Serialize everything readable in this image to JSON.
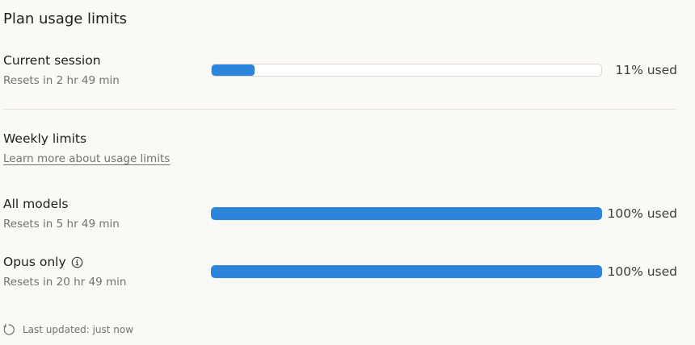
{
  "header": {
    "title": "Plan usage limits"
  },
  "current_session": {
    "label": "Current session",
    "resets": "Resets in 2 hr 49 min",
    "percent_used": 11,
    "percent_text": "11% used"
  },
  "weekly": {
    "heading": "Weekly limits",
    "learn_more": "Learn more about usage limits"
  },
  "all_models": {
    "label": "All models",
    "resets": "Resets in 5 hr 49 min",
    "percent_used": 100,
    "percent_text": "100% used"
  },
  "opus_only": {
    "label": "Opus only",
    "resets": "Resets in 20 hr 49 min",
    "percent_used": 100,
    "percent_text": "100% used",
    "info_icon": "info-icon"
  },
  "footer": {
    "refresh_icon": "refresh-icon",
    "last_updated": "Last updated: just now"
  },
  "colors": {
    "bar_fill": "#2c84db",
    "background": "#faf9f5",
    "muted_text": "#73726c"
  }
}
